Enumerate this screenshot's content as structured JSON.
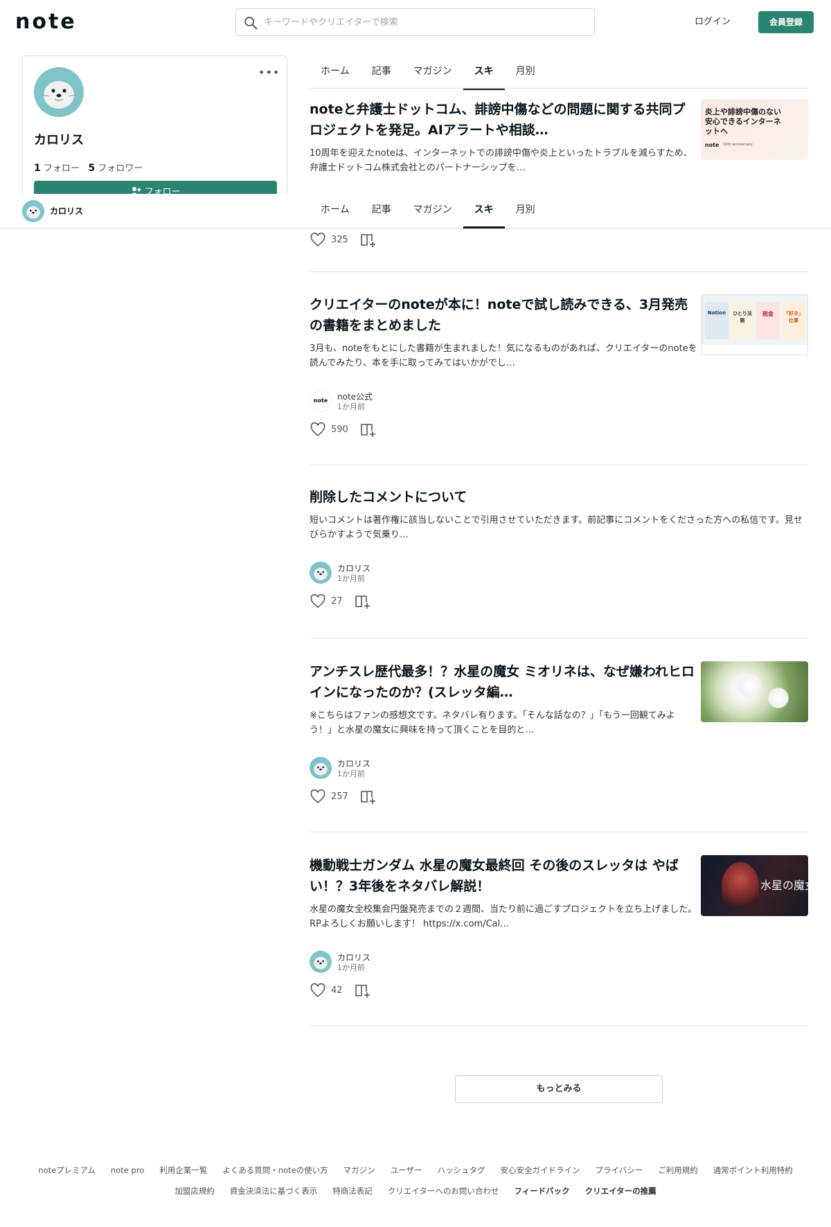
{
  "header": {
    "logo": "note",
    "search_placeholder": "キーワードやクリエイターで検索",
    "login": "ログイン",
    "signup": "会員登録"
  },
  "profile": {
    "name": "カロリス",
    "more": "•••",
    "following_count": "1",
    "following_label": "フォロー",
    "followers_count": "5",
    "followers_label": "フォロワー",
    "follow_button": "フォロー"
  },
  "tabs": [
    {
      "label": "ホーム"
    },
    {
      "label": "記事"
    },
    {
      "label": "マガジン"
    },
    {
      "label": "スキ",
      "active": true
    },
    {
      "label": "月別"
    }
  ],
  "articles": [
    {
      "title": "noteと弁護士ドットコム、誹謗中傷などの問題に関する共同プロジェクトを発足。AIアラートや相談…",
      "excerpt": "10周年を迎えたnoteは、インターネットでの誹謗中傷や炎上といったトラブルを減らすため、弁護士ドットコム株式会社とのパートナーシップを…",
      "thumb_text": "炎上や誹謗中傷のない安心できるインターネットへ",
      "thumb_logo": "note",
      "thumb_sub": "10th anniversary",
      "likes": "325"
    },
    {
      "title": "クリエイターのnoteが本に！noteで試し読みできる、3月発売の書籍をまとめました",
      "excerpt": "3月も、noteをもとにした書籍が生まれました！気になるものがあれば、クリエイターのnoteを読んでみたり、本を手に取ってみてはいかがでし…",
      "thumb_books": [
        "Notion",
        "ひとり法務",
        "税金",
        "「好き」仕事"
      ],
      "author": "note公式",
      "author_avatar_text": "note",
      "date": "1か月前",
      "likes": "590"
    },
    {
      "title": "削除したコメントについて",
      "excerpt": "短いコメントは著作権に該当しないことで引用させていただきます。前記事にコメントをくださった方への私信です。見せびらかすようで気乗り…",
      "author": "カロリス",
      "date": "1か月前",
      "likes": "27"
    },
    {
      "title": "アンチスレ歴代最多！？水星の魔女 ミオリネは、なぜ嫌われヒロインになったのか？(スレッタ編…",
      "excerpt": "※こちらはファンの感想文です。ネタバレ有ります。「そんな話なの？」「もう一回観てみよう！」と水星の魔女に興味を持って頂くことを目的と…",
      "author": "カロリス",
      "date": "1か月前",
      "likes": "257"
    },
    {
      "title": "機動戦士ガンダム 水星の魔女最終回 その後のスレッタは やばい！？3年後をネタバレ解説！",
      "excerpt": "水星の魔女全校集会円盤発売までの２週間、当たり前に過ごすプロジェクトを立ち上げました。 RPよろしくお願いします！ https://x.com/Cal…",
      "thumb_text": "水星の魔女",
      "author": "カロリス",
      "date": "1か月前",
      "likes": "42"
    }
  ],
  "more_button": "もっとみる",
  "footer": {
    "row1": [
      "noteプレミアム",
      "note pro",
      "利用企業一覧",
      "よくある質問・noteの使い方",
      "マガジン",
      "ユーザー",
      "ハッシュタグ",
      "安心安全ガイドライン",
      "プライバシー",
      "ご利用規約",
      "通常ポイント利用特約"
    ],
    "row2": [
      "加盟店規約",
      "資金決済法に基づく表示",
      "特商法表記",
      "クリエイターへのお問い合わせ",
      "フィードバック",
      "クリエイターの推薦"
    ]
  },
  "colors": {
    "accent": "#2b8470",
    "avatar_bg": "#7fc4c8"
  }
}
